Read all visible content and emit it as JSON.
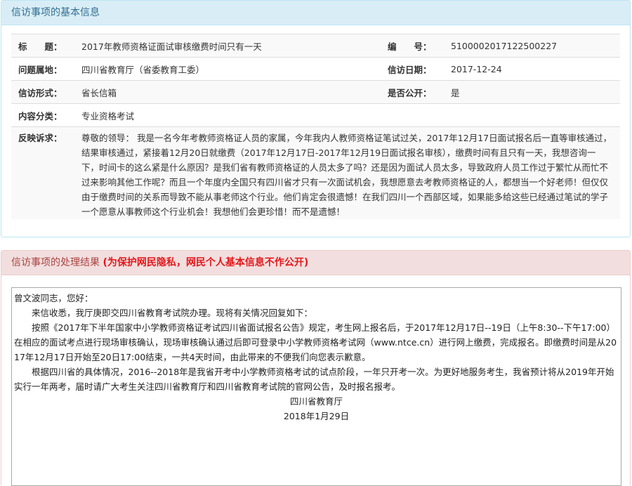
{
  "info_panel": {
    "title": "信访事项的基本信息",
    "fields": {
      "subject_label": "标　　题：",
      "subject_value": "2017年教师资格证面试审核缴费时间只有一天",
      "number_label": "编　　号：",
      "number_value": "5100002017122500227",
      "location_label": "问题属地：",
      "location_value": "四川省教育厅（省委教育工委）",
      "date_label": "信访日期：",
      "date_value": "2017-12-24",
      "form_label": "信访形式：",
      "form_value": "省长信箱",
      "public_label": "是否公开：",
      "public_value": "是",
      "category_label": "内容分类：",
      "category_value": "专业资格考试",
      "appeal_label": "反映诉求：",
      "appeal_value": "尊敬的领导： 我是一名今年考教师资格证人员的家属，今年我内人教师资格证笔试过关，2017年12月17日面试报名后一直等审核通过，结果审核通过，紧接着12月20日就缴费（2017年12月17日-2017年12月19日面试报名审核），缴费时间有且只有一天，我想咨询一下，时间卡的这么紧是什么原因？是我们省有教师资格证的人员太多了吗？还是因为面试人员太多，导致政府人员工作过于繁忙从而忙不过来影响其他工作呢？而且一个年度内全国只有四川省才只有一次面试机会，我想愿意去考教师资格证的人，都想当一个好老师！但仅仅由于缴费时间的关系而导致不能从事老师这个行业。他们肯定会很遗憾！在我们四川一个西部区域，如果能多给这些已经通过笔试的学子一个愿意从事教师这个行业机会！我想他们会更珍惜！而不是遗憾！"
    }
  },
  "result_panel": {
    "title": "信访事项的处理结果",
    "note": "(为保护网民隐私，网民个人基本信息不作公开)",
    "reply": {
      "greeting": "曾文波同志，您好：",
      "p1": "来信收悉，我厅庚即交四川省教育考试院办理。现将有关情况回复如下：",
      "p2": "按照《2017年下半年国家中小学教师资格证考试四川省面试报名公告》规定，考生网上报名后，于2017年12月17日--19日（上午8:30--下午17:00）在相应的面试考点进行现场审核确认，现场审核确认通过后即可登录中小学教师资格考试网（www.ntce.cn）进行网上缴费，完成报名。即缴费时间是从2017年12月17日开始至20日17:00结束，一共4天时间，由此带来的不便我们向您表示歉意。",
      "p3": "根据四川省的具体情况，2016--2018年是我省开考中小学教师资格考试的试点阶段，一年只开考一次。为更好地服务考生，我省预计将从2019年开始实行一年两考，届时请广大考生关注四川省教育厅和四川省教育考试院的官网公告，及时报名报考。",
      "signature": "四川省教育厅",
      "sign_date": "2018年1月29日"
    }
  }
}
